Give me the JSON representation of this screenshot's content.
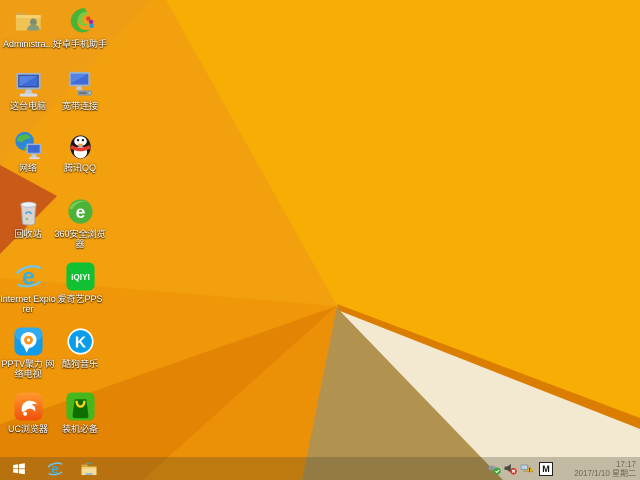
{
  "wallpaper": {
    "colors": {
      "base": "#F4A50D",
      "bright_facet": "#F7AD04",
      "topleft_facet": "#EE9D15",
      "leftmid_facet": "#F2A00E",
      "fan_upper": "#EF9709",
      "fan_lower": "#E38404",
      "pre_fold": "#EC9008",
      "dark_left_triangle": "#C95A18",
      "fold_shadow_tan": "#B2924F",
      "fold_edge_dark": "#DB7D00",
      "paper_white": "#F3E9D1"
    }
  },
  "desktop": {
    "icons": [
      {
        "name": "administrator-folder",
        "label": "Administra...",
        "accent": "#EFC455"
      },
      {
        "name": "haozhuo-phone-assistant",
        "label": "好卓手机助手",
        "accent": "#46B437"
      },
      {
        "name": "this-pc",
        "label": "这台电脑",
        "accent": "#3E6BD8"
      },
      {
        "name": "broadband-connection",
        "label": "宽带连接",
        "accent": "#3E6BD8"
      },
      {
        "name": "network",
        "label": "网络",
        "accent": "#2E86D8"
      },
      {
        "name": "tencent-qq",
        "label": "腾讯QQ",
        "accent": "#E23A2E"
      },
      {
        "name": "recycle-bin",
        "label": "回收站",
        "accent": "#DCE3EA"
      },
      {
        "name": "360-secure-browser",
        "label": "360安全浏览器",
        "accent": "#4DB238",
        "logo_text": "e"
      },
      {
        "name": "internet-explorer",
        "label": "Internet Explorer",
        "accent": "#35AEE4",
        "logo_text": "e"
      },
      {
        "name": "iqiyi-pps",
        "label": "爱奇艺PPS",
        "accent": "#12C034",
        "logo_text": "iQIYI"
      },
      {
        "name": "pptv-network-tv",
        "label": "PPTV聚力 网络电视",
        "accent": "#129BE8"
      },
      {
        "name": "kugou-music",
        "label": "酷狗音乐",
        "accent": "#0C9DE8",
        "logo_text": "K"
      },
      {
        "name": "uc-browser",
        "label": "UC浏览器",
        "accent": "#F4590F"
      },
      {
        "name": "zhuangji-bibei",
        "label": "装机必备",
        "accent": "#44B81D"
      }
    ]
  },
  "taskbar": {
    "tray": {
      "time": "17:17",
      "date": "2017/1/10 星期二",
      "ime_label": "M"
    }
  }
}
